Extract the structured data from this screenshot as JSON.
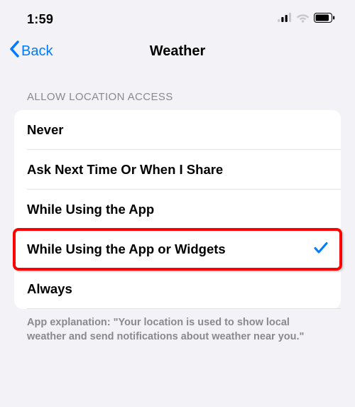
{
  "statusBar": {
    "time": "1:59"
  },
  "nav": {
    "back": "Back",
    "title": "Weather"
  },
  "section": {
    "header": "ALLOW LOCATION ACCESS",
    "options": {
      "never": "Never",
      "askNext": "Ask Next Time Or When I Share",
      "whileUsing": "While Using the App",
      "whileUsingWidgets": "While Using the App or Widgets",
      "always": "Always"
    },
    "footer": "App explanation: \"Your location is used to show local weather and send notifications about weather near you.\""
  },
  "highlightedIndex": 3
}
